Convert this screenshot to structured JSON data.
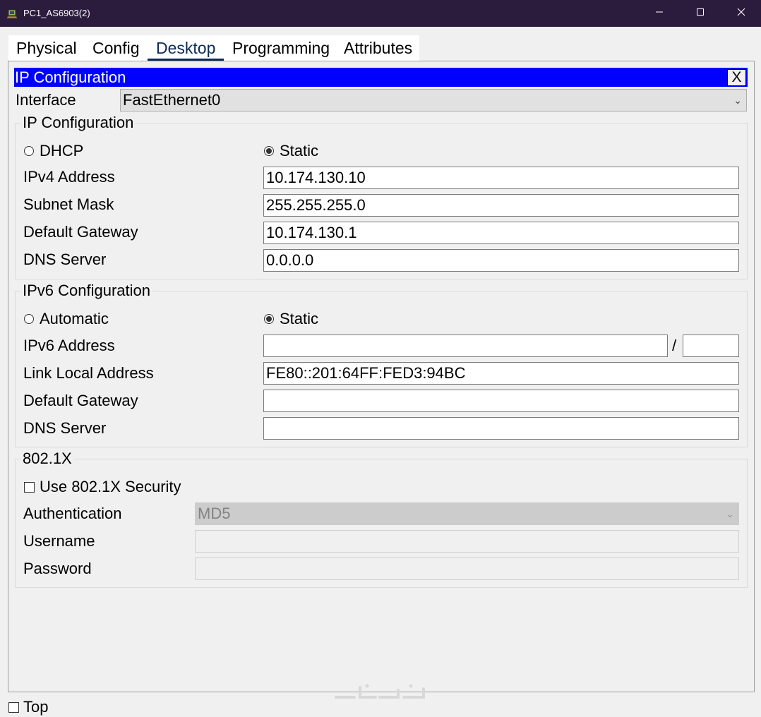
{
  "window": {
    "title": "PC1_AS6903(2)",
    "minimize_icon": "minimize-icon",
    "maximize_icon": "maximize-icon",
    "close_icon": "close-icon"
  },
  "tabs": [
    {
      "label": "Physical",
      "active": false
    },
    {
      "label": "Config",
      "active": false
    },
    {
      "label": "Desktop",
      "active": true
    },
    {
      "label": "Programming",
      "active": false
    },
    {
      "label": "Attributes",
      "active": false
    }
  ],
  "pane": {
    "title": "IP Configuration",
    "close_label": "X",
    "header_color": "#0000ff"
  },
  "interface": {
    "label": "Interface",
    "selected": "FastEthernet0"
  },
  "ipv4": {
    "group_title": "IP Configuration",
    "dhcp_label": "DHCP",
    "static_label": "Static",
    "mode": "Static",
    "address_label": "IPv4 Address",
    "address_value": "10.174.130.10",
    "mask_label": "Subnet Mask",
    "mask_value": "255.255.255.0",
    "gateway_label": "Default Gateway",
    "gateway_value": "10.174.130.1",
    "dns_label": "DNS Server",
    "dns_value": "0.0.0.0"
  },
  "ipv6": {
    "group_title": "IPv6 Configuration",
    "auto_label": "Automatic",
    "static_label": "Static",
    "mode": "Static",
    "address_label": "IPv6 Address",
    "address_value": "",
    "prefix_separator": "/",
    "prefix_value": "",
    "link_local_label": "Link Local Address",
    "link_local_value": "FE80::201:64FF:FED3:94BC",
    "gateway_label": "Default Gateway",
    "gateway_value": "",
    "dns_label": "DNS Server",
    "dns_value": ""
  },
  "dot1x": {
    "group_title": "802.1X",
    "use_label": "Use 802.1X Security",
    "use_checked": false,
    "auth_label": "Authentication",
    "auth_value": "MD5",
    "username_label": "Username",
    "username_value": "",
    "password_label": "Password",
    "password_value": ""
  },
  "footer": {
    "top_label": "Top",
    "top_checked": false
  }
}
